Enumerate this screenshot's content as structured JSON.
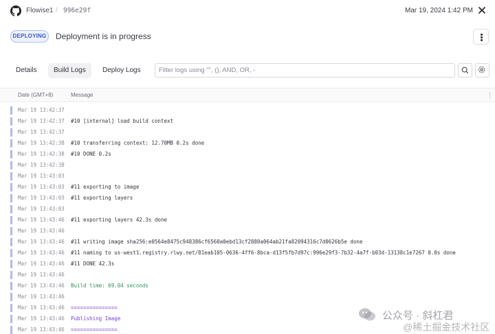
{
  "header": {
    "app_name": "Flowise1",
    "separator": "/",
    "commit": "996e29f",
    "timestamp": "Mar 19, 2024 1:42 PM"
  },
  "status": {
    "badge": "DEPLOYING",
    "text": "Deployment is in progress"
  },
  "tabs": [
    {
      "label": "Details",
      "active": false
    },
    {
      "label": "Build Logs",
      "active": true
    },
    {
      "label": "Deploy Logs",
      "active": false
    }
  ],
  "filter": {
    "placeholder": "Filter logs using \"\", (), AND, OR, -",
    "value": ""
  },
  "columns": {
    "date": "Date (GMT+8)",
    "message": "Message"
  },
  "logs": [
    {
      "date": "Mar 19 13:42:37",
      "message": "",
      "style": "normal"
    },
    {
      "date": "Mar 19 13:42:37",
      "message": "#10 [internal] load build context",
      "style": "normal"
    },
    {
      "date": "Mar 19 13:42:37",
      "message": "",
      "style": "normal"
    },
    {
      "date": "Mar 19 13:42:38",
      "message": "#10 transferring context: 12.70MB 0.2s done",
      "style": "normal"
    },
    {
      "date": "Mar 19 13:42:38",
      "message": "#10 DONE 0.2s",
      "style": "normal"
    },
    {
      "date": "Mar 19 13:42:38",
      "message": "",
      "style": "normal"
    },
    {
      "date": "Mar 19 13:43:03",
      "message": "",
      "style": "normal"
    },
    {
      "date": "Mar 19 13:43:03",
      "message": "#11 exporting to image",
      "style": "normal"
    },
    {
      "date": "Mar 19 13:43:03",
      "message": "#11 exporting layers",
      "style": "normal"
    },
    {
      "date": "Mar 19 13:43:03",
      "message": "",
      "style": "normal"
    },
    {
      "date": "Mar 19 13:43:46",
      "message": "#11 exporting layers 42.3s done",
      "style": "normal"
    },
    {
      "date": "Mar 19 13:43:46",
      "message": "",
      "style": "normal"
    },
    {
      "date": "Mar 19 13:43:46",
      "message": "#11 writing image sha256:e0564e8475c948386cf6560a0ebd13cf2880a064ab21fa82094316c7d0626b5e done",
      "style": "normal"
    },
    {
      "date": "Mar 19 13:43:46",
      "message": "#11 naming to us-west1.registry.rlwy.net/81eab105-0636-4ff6-8bca-d13f5fb7d97c:996e29f3-7b32-4a7f-b03d-13138c1e7267 0.0s done",
      "style": "normal"
    },
    {
      "date": "Mar 19 13:43:46",
      "message": "#11 DONE 42.3s",
      "style": "normal"
    },
    {
      "date": "Mar 19 13:43:46",
      "message": "",
      "style": "normal"
    },
    {
      "date": "Mar 19 13:43:46",
      "message": "Build time: 69.04 seconds",
      "style": "green"
    },
    {
      "date": "Mar 19 13:43:46",
      "message": "",
      "style": "normal"
    },
    {
      "date": "Mar 19 13:43:46",
      "message": "===============",
      "style": "purple"
    },
    {
      "date": "Mar 19 13:43:46",
      "message": "Publishing Image",
      "style": "purple"
    },
    {
      "date": "Mar 19 13:43:46",
      "message": "===============",
      "style": "purple"
    }
  ],
  "watermark": {
    "line1": "公众号 · 斜杠君",
    "line2": "@稀土掘金技术社区"
  },
  "colors": {
    "accent": "#3656c8",
    "log_bar": "#aeb9ee",
    "build_time": "#2f8f5f",
    "publishing": "#7a3fd1"
  },
  "icons": [
    "github-icon",
    "close-icon",
    "more-vertical-icon",
    "search-icon",
    "gear-icon"
  ]
}
